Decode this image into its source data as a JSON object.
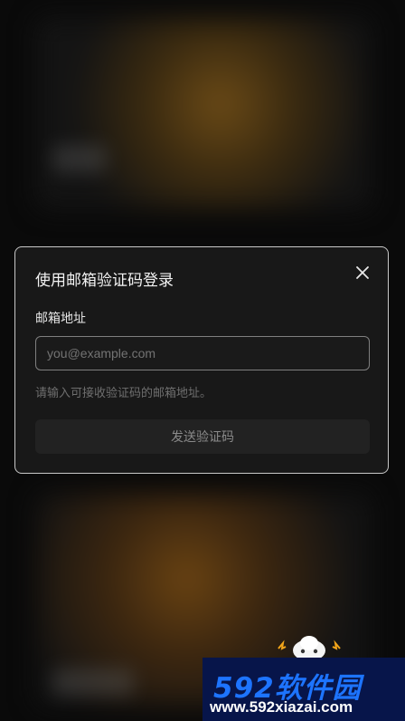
{
  "modal": {
    "title": "使用邮箱验证码登录",
    "email_label": "邮箱地址",
    "email_placeholder": "you@example.com",
    "email_value": "",
    "hint": "请输入可接收验证码的邮箱地址。",
    "send_button_label": "发送验证码",
    "close_icon": "close-icon"
  },
  "watermark": {
    "logo_text": "592软件园",
    "url_text": "www.592xiazai.com"
  },
  "colors": {
    "modal_bg": "#181818",
    "modal_border": "#c9c9c9",
    "watermark_bg": "#07154a",
    "watermark_logo": "#1d74ff"
  }
}
